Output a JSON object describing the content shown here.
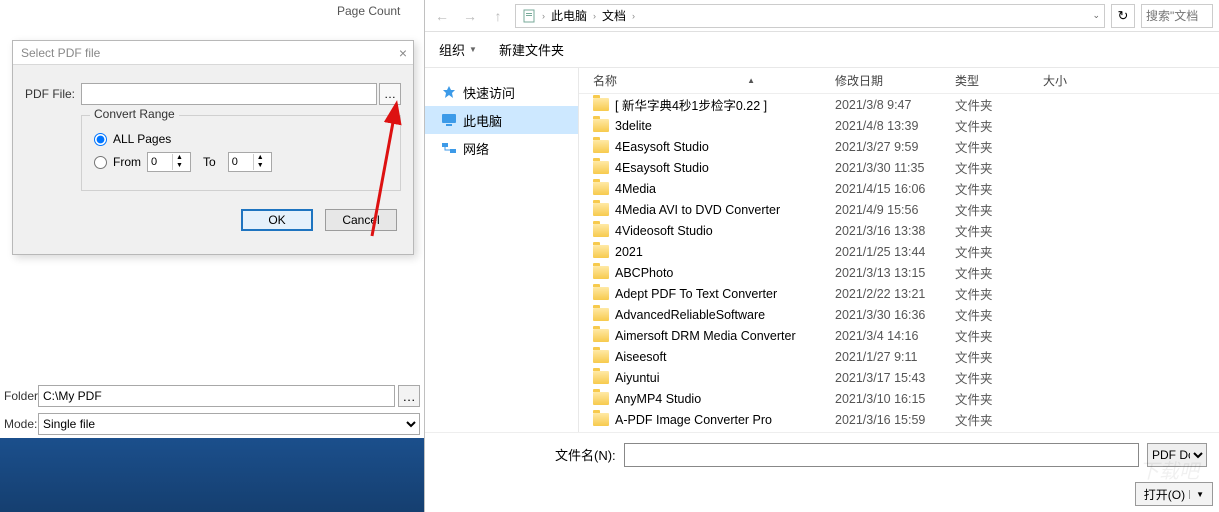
{
  "leftApp": {
    "pageCountLabel": "Page Count",
    "dialog": {
      "title": "Select PDF file",
      "pdfFileLabel": "PDF File:",
      "browseGlyph": "…",
      "convertRangeTitle": "Convert Range",
      "allPagesLabel": "ALL Pages",
      "fromLabel": "From",
      "fromValue": "0",
      "toLabel": "To",
      "toValue": "0",
      "okLabel": "OK",
      "cancelLabel": "Cancel"
    },
    "bottom": {
      "folderLabel": "Folder:",
      "folderValue": "C:\\My PDF",
      "modeLabel": "Mode:",
      "modeValue": "Single file"
    }
  },
  "fileDialog": {
    "breadcrumbs": [
      "此电脑",
      "文档"
    ],
    "refreshGlyph": "↻",
    "searchPlaceholder": "搜索\"文档",
    "toolbar": {
      "organize": "组织",
      "newFolder": "新建文件夹"
    },
    "nav": {
      "quickAccess": "快速访问",
      "thisPc": "此电脑",
      "network": "网络"
    },
    "columns": {
      "name": "名称",
      "date": "修改日期",
      "type": "类型",
      "size": "大小"
    },
    "files": [
      {
        "name": "[ 新华字典4秒1步检字0.22 ]",
        "date": "2021/3/8 9:47",
        "type": "文件夹"
      },
      {
        "name": "3delite",
        "date": "2021/4/8 13:39",
        "type": "文件夹"
      },
      {
        "name": "4Easysoft Studio",
        "date": "2021/3/27 9:59",
        "type": "文件夹"
      },
      {
        "name": "4Esaysoft Studio",
        "date": "2021/3/30 11:35",
        "type": "文件夹"
      },
      {
        "name": "4Media",
        "date": "2021/4/15 16:06",
        "type": "文件夹"
      },
      {
        "name": "4Media AVI to DVD Converter",
        "date": "2021/4/9 15:56",
        "type": "文件夹"
      },
      {
        "name": "4Videosoft Studio",
        "date": "2021/3/16 13:38",
        "type": "文件夹"
      },
      {
        "name": "2021",
        "date": "2021/1/25 13:44",
        "type": "文件夹"
      },
      {
        "name": "ABCPhoto",
        "date": "2021/3/13 13:15",
        "type": "文件夹"
      },
      {
        "name": "Adept PDF To Text Converter",
        "date": "2021/2/22 13:21",
        "type": "文件夹"
      },
      {
        "name": "AdvancedReliableSoftware",
        "date": "2021/3/30 16:36",
        "type": "文件夹"
      },
      {
        "name": "Aimersoft DRM Media Converter",
        "date": "2021/3/4 14:16",
        "type": "文件夹"
      },
      {
        "name": "Aiseesoft",
        "date": "2021/1/27 9:11",
        "type": "文件夹"
      },
      {
        "name": "Aiyuntui",
        "date": "2021/3/17 15:43",
        "type": "文件夹"
      },
      {
        "name": "AnyMP4 Studio",
        "date": "2021/3/10 16:15",
        "type": "文件夹"
      },
      {
        "name": "A-PDF Image Converter Pro",
        "date": "2021/3/16 15:59",
        "type": "文件夹"
      }
    ],
    "filenameLabel": "文件名(N):",
    "filterText": "PDF Docu",
    "openLabel": "打开(O)"
  }
}
